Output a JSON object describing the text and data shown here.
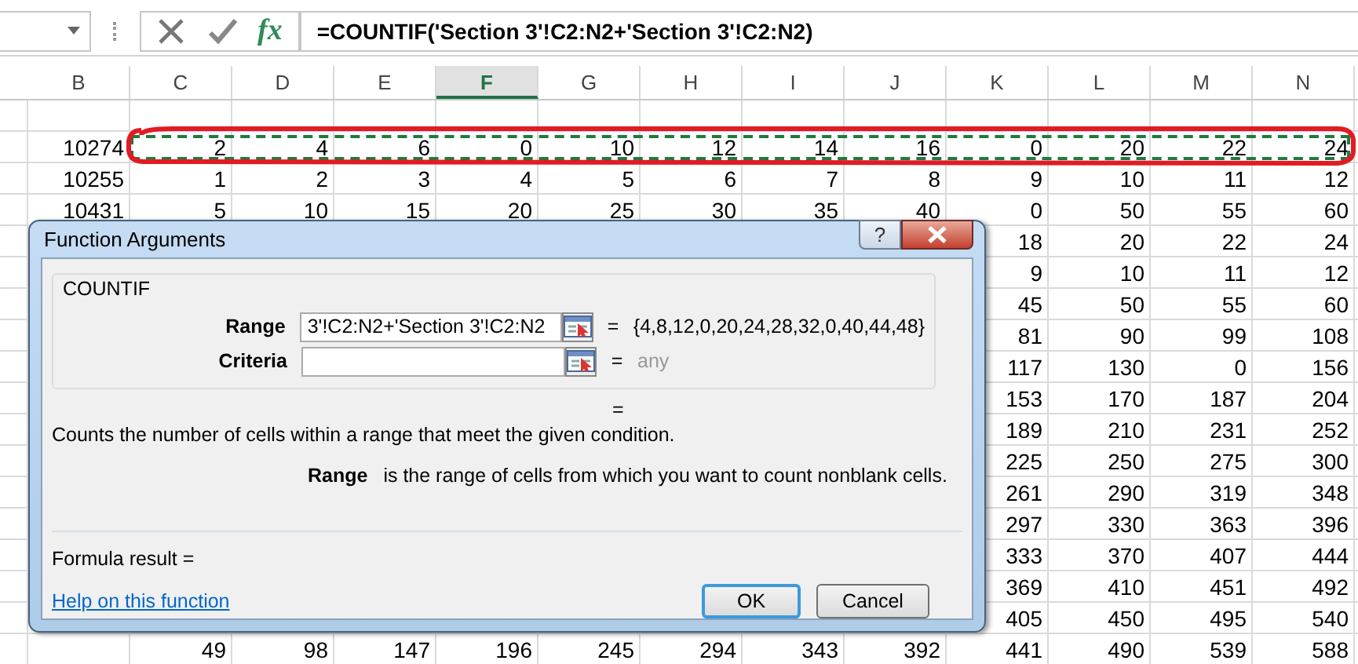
{
  "formula_bar": {
    "insert_function": "fx",
    "formula": "=COUNTIF('Section 3'!C2:N2+'Section 3'!C2:N2)"
  },
  "columns": [
    {
      "label": "B",
      "selected": false
    },
    {
      "label": "C",
      "selected": false
    },
    {
      "label": "D",
      "selected": false
    },
    {
      "label": "E",
      "selected": false
    },
    {
      "label": "F",
      "selected": true
    },
    {
      "label": "G",
      "selected": false
    },
    {
      "label": "H",
      "selected": false
    },
    {
      "label": "I",
      "selected": false
    },
    {
      "label": "J",
      "selected": false
    },
    {
      "label": "K",
      "selected": false
    },
    {
      "label": "L",
      "selected": false
    },
    {
      "label": "M",
      "selected": false
    },
    {
      "label": "N",
      "selected": false
    }
  ],
  "rows": [
    {
      "b": "10274",
      "c_to_j": [
        "2",
        "4",
        "6",
        "0",
        "10",
        "12",
        "14",
        "16"
      ],
      "k_to_n": [
        "0",
        "20",
        "22",
        "24"
      ],
      "circled": true,
      "marquee": true
    },
    {
      "b": "10255",
      "c_to_j": [
        "1",
        "2",
        "3",
        "4",
        "5",
        "6",
        "7",
        "8"
      ],
      "k_to_n": [
        "9",
        "10",
        "11",
        "12"
      ]
    },
    {
      "b": "10431",
      "c_to_j": [
        "5",
        "10",
        "15",
        "20",
        "25",
        "30",
        "35",
        "40"
      ],
      "k_to_n": [
        "0",
        "50",
        "55",
        "60"
      ]
    },
    {
      "k_to_n": [
        "18",
        "20",
        "22",
        "24"
      ]
    },
    {
      "k_to_n": [
        "9",
        "10",
        "11",
        "12"
      ]
    },
    {
      "k_to_n": [
        "45",
        "50",
        "55",
        "60"
      ]
    },
    {
      "k_to_n": [
        "81",
        "90",
        "99",
        "108"
      ]
    },
    {
      "k_to_n": [
        "117",
        "130",
        "0",
        "156"
      ]
    },
    {
      "k_to_n": [
        "153",
        "170",
        "187",
        "204"
      ]
    },
    {
      "k_to_n": [
        "189",
        "210",
        "231",
        "252"
      ]
    },
    {
      "k_to_n": [
        "225",
        "250",
        "275",
        "300"
      ]
    },
    {
      "k_to_n": [
        "261",
        "290",
        "319",
        "348"
      ]
    },
    {
      "k_to_n": [
        "297",
        "330",
        "363",
        "396"
      ]
    },
    {
      "k_to_n": [
        "333",
        "370",
        "407",
        "444"
      ]
    },
    {
      "k_to_n": [
        "369",
        "410",
        "451",
        "492"
      ]
    },
    {
      "k_to_n": [
        "405",
        "450",
        "495",
        "540"
      ]
    },
    {
      "c_to_j": [
        "49",
        "98",
        "147",
        "196",
        "245",
        "294",
        "343",
        "392"
      ],
      "k_to_n": [
        "441",
        "490",
        "539",
        "588"
      ]
    }
  ],
  "dialog": {
    "title": "Function Arguments",
    "help_button": "?",
    "function_name": "COUNTIF",
    "arguments": [
      {
        "label": "Range",
        "value": "3'!C2:N2+'Section 3'!C2:N2",
        "equals": "=",
        "result": "{4,8,12,0,20,24,28,32,0,40,44,48}",
        "greyed": false
      },
      {
        "label": "Criteria",
        "equals": "=",
        "result": "any",
        "greyed": true
      }
    ],
    "formula_equals": "=",
    "description": "Counts the number of cells within a range that meet the given condition.",
    "argument_help": {
      "name": "Range",
      "text": "is the range of cells from which you want to count nonblank cells."
    },
    "formula_result": "Formula result =",
    "help_link": "Help on this function",
    "buttons": [
      {
        "label": "OK",
        "default": true
      },
      {
        "label": "Cancel",
        "default": false
      }
    ]
  }
}
